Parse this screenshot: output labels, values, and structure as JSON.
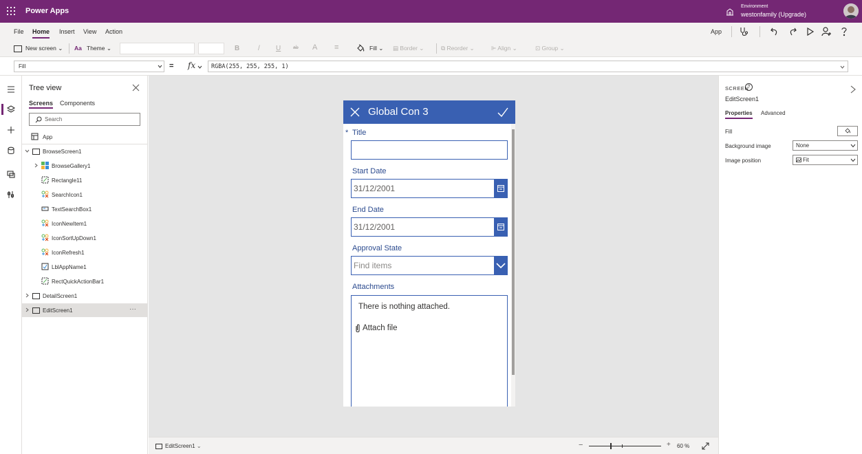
{
  "titlebar": {
    "app_name": "Power Apps",
    "environment_label": "Environment",
    "environment_value": "westonfamily (Upgrade)",
    "accent": "#742774"
  },
  "menubar": {
    "items": [
      "File",
      "Home",
      "Insert",
      "View",
      "Action"
    ],
    "active": "Home",
    "app_label": "App"
  },
  "ribbon": {
    "new_screen": "New screen",
    "theme": "Theme",
    "bold": "B",
    "italic": "/",
    "underline": "U",
    "strike": "ab",
    "font_color": "A",
    "align_text": "≡",
    "fill": "Fill",
    "border": "Border",
    "reorder": "Reorder",
    "align": "Align",
    "group": "Group"
  },
  "formula": {
    "property": "Fill",
    "equals": "=",
    "fx": "fx",
    "expression": "RGBA(255, 255, 255, 1)"
  },
  "tree": {
    "title": "Tree view",
    "tabs": [
      "Screens",
      "Components"
    ],
    "search_placeholder": "Search",
    "app": "App",
    "items": [
      {
        "label": "BrowseScreen1",
        "icon": "screen-icon"
      },
      {
        "label": "BrowseGallery1",
        "icon": "gallery-icon"
      },
      {
        "label": "Rectangle11",
        "icon": "rectangle-icon"
      },
      {
        "label": "SearchIcon1",
        "icon": "icon-control-icon"
      },
      {
        "label": "TextSearchBox1",
        "icon": "textinput-icon"
      },
      {
        "label": "IconNewItem1",
        "icon": "icon-control-icon"
      },
      {
        "label": "IconSortUpDown1",
        "icon": "icon-control-icon"
      },
      {
        "label": "IconRefresh1",
        "icon": "icon-control-icon"
      },
      {
        "label": "LblAppName1",
        "icon": "label-icon"
      },
      {
        "label": "RectQuickActionBar1",
        "icon": "rectangle-icon"
      },
      {
        "label": "DetailScreen1",
        "icon": "screen-icon"
      },
      {
        "label": "EditScreen1",
        "icon": "screen-icon"
      }
    ],
    "more": "···"
  },
  "phone": {
    "header_title": "Global Con 3",
    "header_color": "#3960b2",
    "required_mark": "*",
    "fields": {
      "title_label": "Title",
      "title_value": "",
      "start_label": "Start Date",
      "start_value": "31/12/2001",
      "end_label": "End Date",
      "end_value": "31/12/2001",
      "approval_label": "Approval State",
      "approval_placeholder": "Find items",
      "attachments_label": "Attachments",
      "attachments_empty": "There is nothing attached.",
      "attach_file": "Attach file"
    }
  },
  "statusbar": {
    "screen": "EditScreen1",
    "zoom_minus": "−",
    "zoom_plus": "+",
    "zoom": "60 %"
  },
  "props": {
    "kind": "SCREEN",
    "name": "EditScreen1",
    "tabs": [
      "Properties",
      "Advanced"
    ],
    "rows": [
      {
        "label": "Fill"
      },
      {
        "label": "Background image",
        "value": "None"
      },
      {
        "label": "Image position",
        "value": "Fit"
      }
    ]
  }
}
